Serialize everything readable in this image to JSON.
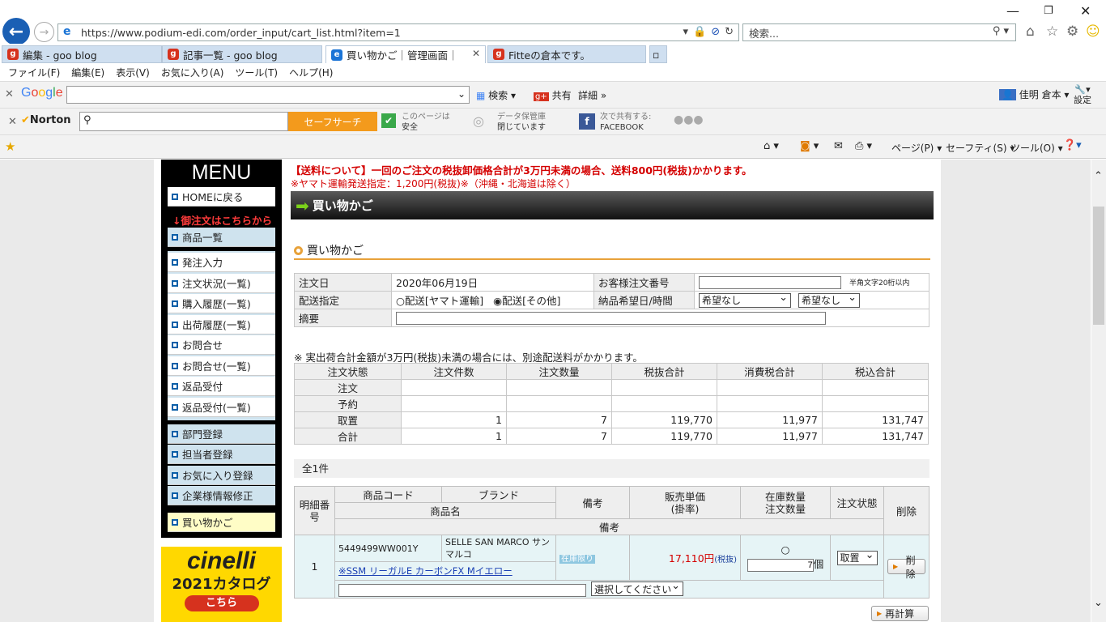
{
  "browser": {
    "address": "https://www.podium-edi.com/order_input/cart_list.html?item=1",
    "search_placeholder": "検索...",
    "tabs": [
      "編集 - goo blog",
      "記事一覧 - goo blog",
      "買い物かご｜管理画面｜",
      "Fitteの倉本です。"
    ],
    "menu": [
      "ファイル(F)",
      "編集(E)",
      "表示(V)",
      "お気に入り(A)",
      "ツール(T)",
      "ヘルプ(H)"
    ],
    "google": {
      "search_label": "検索",
      "share_label": "共有",
      "detail_label": "詳細",
      "user": "佳明 倉本",
      "settings": "設定"
    },
    "norton": {
      "safe_search": "セーフサーチ",
      "page_status_1": "このページは",
      "page_status_2": "安全",
      "vault_1": "データ保管庫",
      "vault_2": "閉じています",
      "share_1": "次で共有する:",
      "share_2": "FACEBOOK",
      "brand": "Norton"
    },
    "cmd": [
      "ページ(P)",
      "セーフティ(S)",
      "ツール(O)"
    ]
  },
  "sidebar": {
    "title": "MENU",
    "home": "HOMEに戻る",
    "order_here": "↓御注文はこちらから",
    "items": [
      "商品一覧",
      "発注入力",
      "注文状況(一覧)",
      "購入履歴(一覧)",
      "出荷履歴(一覧)",
      "お問合せ",
      "お問合せ(一覧)",
      "返品受付",
      "返品受付(一覧)"
    ],
    "items2": [
      "部門登録",
      "担当者登録",
      "お気に入り登録",
      "企業様情報修正"
    ],
    "cart": "買い物かご",
    "banner_brand": "cinelli",
    "banner_text": "2021カタログ",
    "banner_btn": "こちら"
  },
  "notice": {
    "line1": "【送料について】一回のご注文の税抜卸価格合計が3万円未満の場合、送料800円(税抜)かかります。",
    "line2": "※ヤマト運輸発送指定：1,200円(税抜)※（沖縄・北海道は除く）"
  },
  "header_title": "買い物かご",
  "section_title": "買い物かご",
  "order_form": {
    "date_label": "注文日",
    "date_value": "2020年06月19日",
    "customer_no_label": "お客様注文番号",
    "customer_no_hint": "半角文字20桁以内",
    "delivery_label": "配送指定",
    "delivery_opt1": "配送[ヤマト運輸]",
    "delivery_opt2": "配送[その他]",
    "due_label": "納品希望日/時間",
    "due_date": "希望なし",
    "due_time": "希望なし",
    "memo_label": "摘要"
  },
  "summary_note": "※ 実出荷合計金額が3万円(税抜)未満の場合には、別途配送料がかかります。",
  "summary": {
    "headers": [
      "注文状態",
      "注文件数",
      "注文数量",
      "税抜合計",
      "消費税合計",
      "税込合計"
    ],
    "rows": [
      [
        "注文",
        "",
        "",
        "",
        "",
        ""
      ],
      [
        "予約",
        "",
        "",
        "",
        "",
        ""
      ],
      [
        "取置",
        "1",
        "7",
        "119,770",
        "11,977",
        "131,747"
      ],
      [
        "合計",
        "1",
        "7",
        "119,770",
        "11,977",
        "131,747"
      ]
    ]
  },
  "count_label": "全1件",
  "cart": {
    "h_line_no": "明細番号",
    "h_code": "商品コード",
    "h_brand": "ブランド",
    "h_name": "商品名",
    "h_note": "備考",
    "h_price": "販売単価\n(掛率)",
    "h_stock": "在庫数量\n注文数量",
    "h_status": "注文状態",
    "h_delete": "削除",
    "h_note2": "備考",
    "item": {
      "no": "1",
      "code": "5449499WW001Y",
      "brand": "SELLE SAN MARCO サンマルコ",
      "name": "※SSM リーガルE カーボンFX Mイエロー",
      "stock_badge": "在庫限り",
      "price": "17,110",
      "price_unit": "円",
      "tax": "(税抜)",
      "stock": "○",
      "qty": "7",
      "qty_unit": "個",
      "status": "取置",
      "delete": "削除",
      "note_select": "選択してください"
    }
  },
  "recalc": "再計算"
}
